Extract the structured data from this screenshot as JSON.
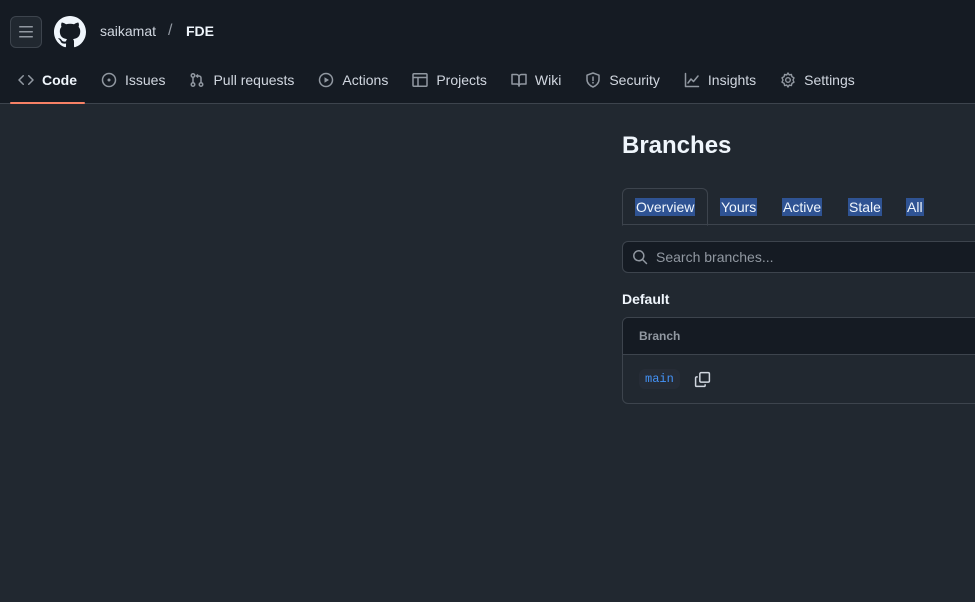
{
  "header": {
    "owner": "saikamat",
    "separator": "/",
    "repo": "FDE"
  },
  "tabs": [
    {
      "label": "Code",
      "icon": "code-icon",
      "selected": true
    },
    {
      "label": "Issues",
      "icon": "issue-opened-icon"
    },
    {
      "label": "Pull requests",
      "icon": "git-pull-request-icon"
    },
    {
      "label": "Actions",
      "icon": "play-icon"
    },
    {
      "label": "Projects",
      "icon": "table-icon"
    },
    {
      "label": "Wiki",
      "icon": "book-icon"
    },
    {
      "label": "Security",
      "icon": "shield-icon"
    },
    {
      "label": "Insights",
      "icon": "graph-icon"
    },
    {
      "label": "Settings",
      "icon": "gear-icon"
    }
  ],
  "page": {
    "title": "Branches",
    "subtabs": [
      "Overview",
      "Yours",
      "Active",
      "Stale",
      "All"
    ],
    "search_placeholder": "Search branches...",
    "section_title": "Default",
    "table": {
      "column_header": "Branch",
      "rows": [
        {
          "name": "main"
        }
      ]
    }
  },
  "colors": {
    "background": "#212830",
    "header_bg": "#151b23",
    "accent_underline": "#f78166",
    "link": "#4493f8",
    "selection": "#2f5393"
  }
}
